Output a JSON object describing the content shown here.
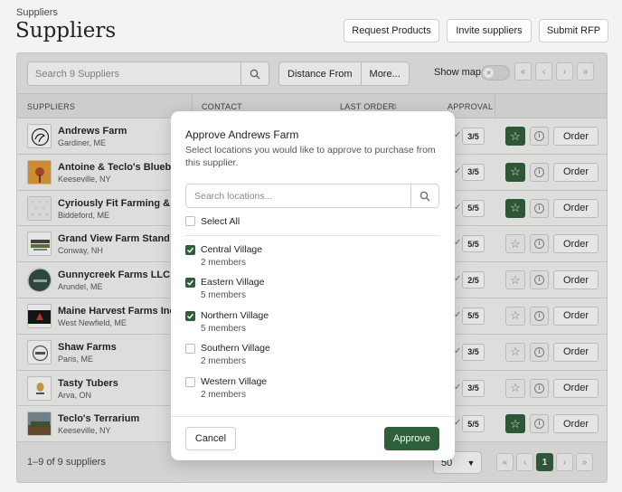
{
  "header": {
    "breadcrumb": "Suppliers",
    "title": "Suppliers",
    "actions": [
      "Request Products",
      "Invite suppliers",
      "Submit RFP"
    ]
  },
  "toolbar": {
    "search_placeholder": "Search 9 Suppliers",
    "filters": [
      "Distance From",
      "More..."
    ],
    "show_map_label": "Show map",
    "show_map_on": false
  },
  "table": {
    "columns": [
      "SUPPLIERS",
      "CONTACT",
      "LAST ORDER",
      "APPROVAL"
    ],
    "order_label": "Order",
    "rows": [
      {
        "name": "Andrews Farm",
        "location": "Gardiner, ME",
        "approval": "3/5",
        "favorite": true
      },
      {
        "name": "Antoine & Teclo's Blueberries",
        "location": "Keeseville, NY",
        "approval": "3/5",
        "favorite": true
      },
      {
        "name": "Cyriously Fit Farming & Wellness",
        "location": "Biddeford, ME",
        "approval": "5/5",
        "favorite": true
      },
      {
        "name": "Grand View Farm Stand",
        "location": "Conway, NH",
        "approval": "5/5",
        "favorite": false
      },
      {
        "name": "Gunnycreek Farms LLC",
        "location": "Arundel, ME",
        "approval": "2/5",
        "favorite": false
      },
      {
        "name": "Maine Harvest Farms Inc.",
        "location": "West Newfield, ME",
        "approval": "5/5",
        "favorite": false
      },
      {
        "name": "Shaw Farms",
        "location": "Paris, ME",
        "approval": "3/5",
        "favorite": false
      },
      {
        "name": "Tasty Tubers",
        "location": "Arva, ON",
        "approval": "3/5",
        "favorite": false
      },
      {
        "name": "Teclo's Terrarium",
        "location": "Keeseville, NY",
        "approval": "5/5",
        "favorite": true
      }
    ]
  },
  "footer": {
    "count_label": "1–9 of 9 suppliers",
    "per_page": "50",
    "current_page": "1"
  },
  "modal": {
    "title": "Approve Andrews Farm",
    "description": "Select locations you would like to approve to purchase from this supplier.",
    "search_placeholder": "Search locations...",
    "select_all_label": "Select All",
    "select_all_checked": false,
    "locations": [
      {
        "name": "Central Village",
        "members": "2 members",
        "checked": true
      },
      {
        "name": "Eastern Village",
        "members": "5 members",
        "checked": true
      },
      {
        "name": "Northern Village",
        "members": "5 members",
        "checked": true
      },
      {
        "name": "Southern Village",
        "members": "2 members",
        "checked": false
      },
      {
        "name": "Western Village",
        "members": "2 members",
        "checked": false
      }
    ],
    "cancel_label": "Cancel",
    "approve_label": "Approve"
  },
  "colors": {
    "accent": "#2e5e3a"
  }
}
